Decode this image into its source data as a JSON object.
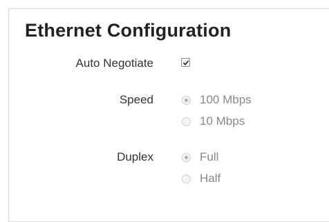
{
  "title": "Ethernet Configuration",
  "auto_negotiate": {
    "label": "Auto Negotiate",
    "checked": true
  },
  "speed": {
    "label": "Speed",
    "options": [
      {
        "label": "100 Mbps",
        "selected": true
      },
      {
        "label": "10 Mbps",
        "selected": false
      }
    ]
  },
  "duplex": {
    "label": "Duplex",
    "options": [
      {
        "label": "Full",
        "selected": true
      },
      {
        "label": "Half",
        "selected": false
      }
    ]
  },
  "colors": {
    "text": "#333333",
    "disabled_text": "#888888",
    "border": "#d6d6d6"
  }
}
